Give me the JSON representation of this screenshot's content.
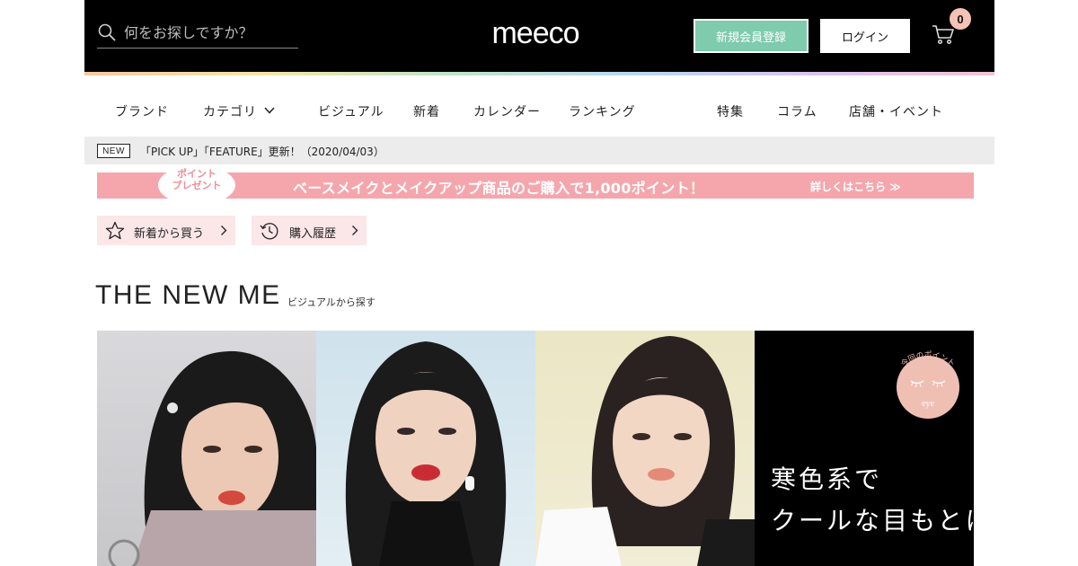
{
  "header": {
    "search_placeholder": "何をお探しですか？",
    "logo_text": "meeco",
    "register_label": "新規会員登録",
    "login_label": "ログイン",
    "cart_count": "0"
  },
  "nav": {
    "items": [
      "ブランド",
      "カテゴリ",
      "ビジュアル",
      "新着",
      "カレンダー",
      "ランキング",
      "特集",
      "コラム",
      "店舗・イベント"
    ]
  },
  "news": {
    "badge": "NEW",
    "text": "「PICK UP」「FEATURE」更新！（2020/04/03）"
  },
  "promo": {
    "circle_line1": "ポイント",
    "circle_line2": "プレゼント",
    "text": "ベースメイクとメイクアップ商品のご購入で1,000ポイント！",
    "more": "詳しくはこちら ≫"
  },
  "quick_links": [
    {
      "label": "新着から買う",
      "icon": "star-icon"
    },
    {
      "label": "購入履歴",
      "icon": "history-icon"
    }
  ],
  "section": {
    "title": "THE NEW ME",
    "subtitle": "ビジュアルから探す"
  },
  "visual": {
    "badge_arc": "今回のポイント",
    "badge_word": "eye",
    "text_line1": "寒色系で",
    "text_line2": "クールな目もとに"
  },
  "colors": {
    "header_bg": "#000000",
    "register_bg": "#7ecbad",
    "cart_badge": "#f4c3b6",
    "promo_bg": "#f5a6ad",
    "quick_bg": "#fbe6e8"
  }
}
